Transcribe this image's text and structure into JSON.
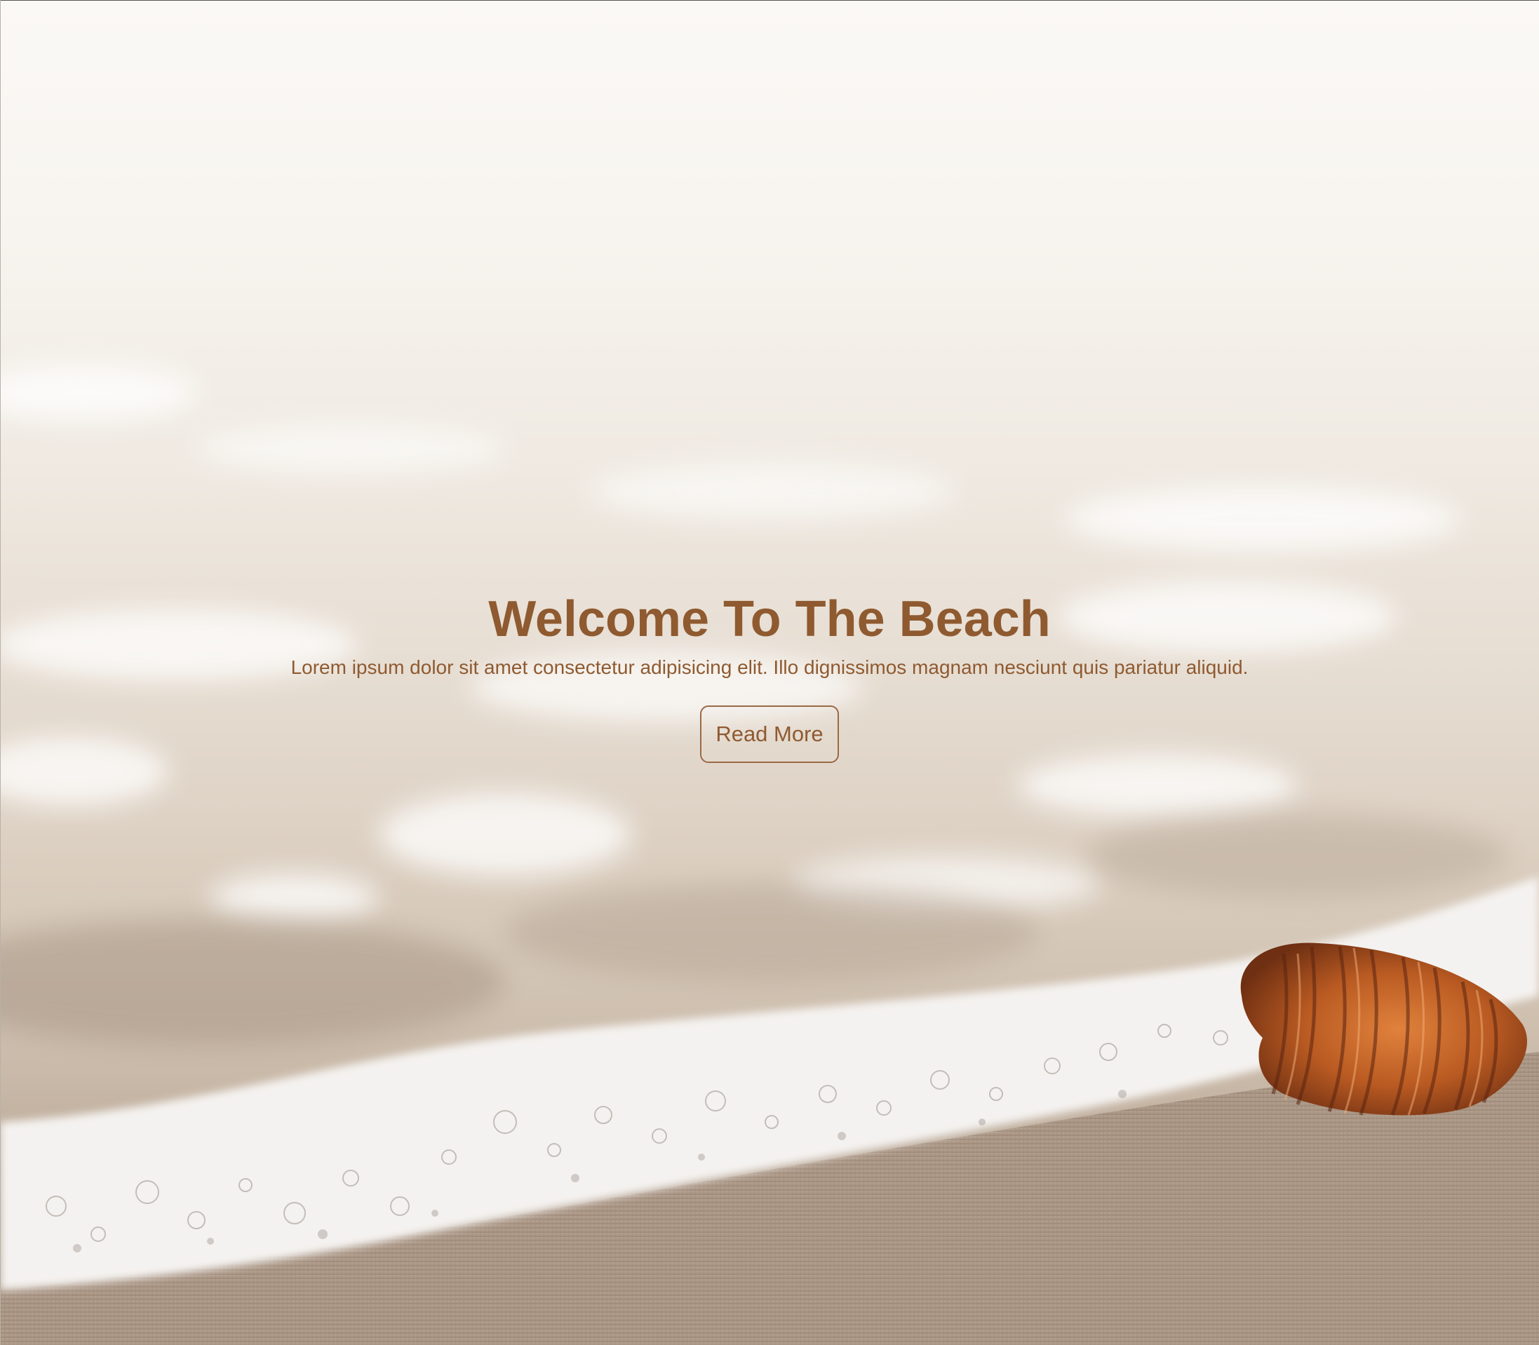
{
  "hero": {
    "title": "Welcome To The Beach",
    "subtitle": "Lorem ipsum dolor sit amet consectetur adipisicing elit. Illo dignissimos magnam nesciunt quis pariatur aliquid.",
    "button_label": "Read More"
  },
  "background": {
    "scene": "beach-sand-foam-seashell",
    "colors": {
      "text_accent": "#8f5a30",
      "foam": "#f4f1ee",
      "sand": "#a89483",
      "shell": "#c2652a"
    }
  }
}
